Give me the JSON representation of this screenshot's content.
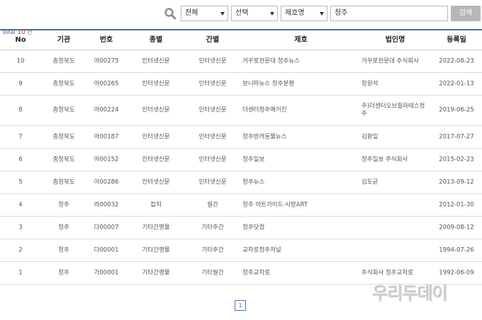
{
  "search": {
    "select1": "전체",
    "select2": "선택",
    "select3": "제호명",
    "query": "청주",
    "button_label": "검색"
  },
  "total": {
    "label": "Total",
    "count": "10",
    "unit": "건"
  },
  "table": {
    "headers": {
      "no": "No",
      "org": "기관",
      "num": "번호",
      "type": "종별",
      "freq": "간별",
      "title": "제호",
      "corp": "법인명",
      "date": "등록일"
    },
    "rows": [
      {
        "no": "10",
        "org": "충청북도",
        "num": "아00275",
        "type": "인터넷신문",
        "freq": "인터넷신문",
        "title": "거꾸로천문대 청주뉴스",
        "corp": "거꾸로천문대 주식회사",
        "date": "2022-08-23"
      },
      {
        "no": "9",
        "org": "충청북도",
        "num": "아00265",
        "type": "인터넷신문",
        "freq": "인터넷신문",
        "title": "보니따뉴스 청주분평",
        "corp": "장원석",
        "date": "2022-01-13"
      },
      {
        "no": "8",
        "org": "충청북도",
        "num": "아00224",
        "type": "인터넷신문",
        "freq": "인터넷신문",
        "title": "더센터청주매거진",
        "corp": "주)더센터오브필라테스청주",
        "date": "2019-06-25"
      },
      {
        "no": "7",
        "org": "충청북도",
        "num": "아00187",
        "type": "인터넷신문",
        "freq": "인터넷신문",
        "title": "청주반려동물뉴스",
        "corp": "김환일",
        "date": "2017-07-27"
      },
      {
        "no": "6",
        "org": "충청북도",
        "num": "아00152",
        "type": "인터넷신문",
        "freq": "인터넷신문",
        "title": "청주일보",
        "corp": "청주일보 주식회사",
        "date": "2015-02-23"
      },
      {
        "no": "5",
        "org": "충청북도",
        "num": "아00286",
        "type": "인터넷신문",
        "freq": "인터넷신문",
        "title": "청주뉴스",
        "corp": "김도균",
        "date": "2013-09-12"
      },
      {
        "no": "4",
        "org": "청주",
        "num": "라00032",
        "type": "잡지",
        "freq": "월간",
        "title": "청주 아트가이드·시방ART",
        "corp": "",
        "date": "2012-01-30"
      },
      {
        "no": "3",
        "org": "청주",
        "num": "다00007",
        "type": "기타간행물",
        "freq": "기타주간",
        "title": "청주닷컴",
        "corp": "",
        "date": "2009-08-12"
      },
      {
        "no": "2",
        "org": "청주",
        "num": "다00001",
        "type": "기타간행물",
        "freq": "기타주간",
        "title": "교차로청주저널",
        "corp": "",
        "date": "1994-07-26"
      },
      {
        "no": "1",
        "org": "청주",
        "num": "가00001",
        "type": "기타간행물",
        "freq": "기타월간",
        "title": "청주교차로",
        "corp": "주식회사 청주교차로",
        "date": "1992-06-09"
      }
    ]
  },
  "pagination": {
    "current": "1"
  },
  "watermark": "우리두데이"
}
